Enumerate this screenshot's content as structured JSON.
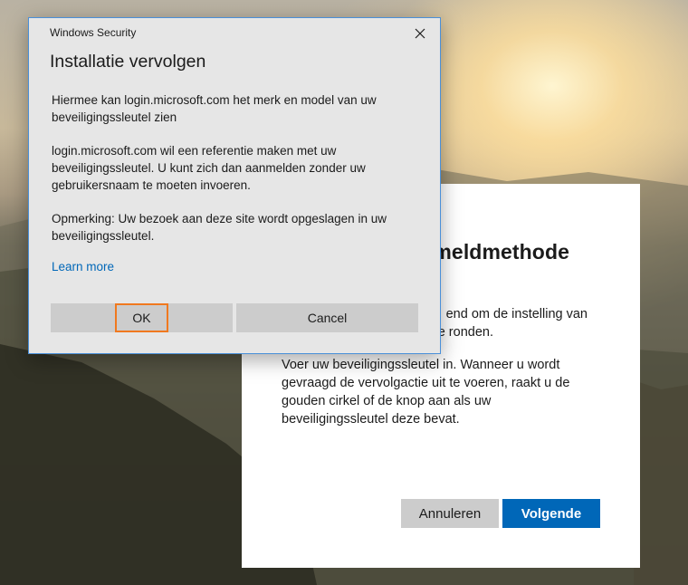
{
  "windows_security_dialog": {
    "window_title": "Windows Security",
    "heading": "Installatie vervolgen",
    "paragraph_1": "Hiermee kan login.microsoft.com het merk en model van uw beveiligingssleutel zien",
    "paragraph_2": "login.microsoft.com wil een referentie maken met uw beveiligingssleutel. U kunt zich dan aanmelden zonder uw gebruikersnaam te moeten invoeren.",
    "paragraph_3": "Opmerking: Uw bezoek aan deze site wordt opgeslagen in uw beveiligingssleutel.",
    "learn_more_link": "Learn more",
    "ok_button": "OK",
    "cancel_button": "Cancel",
    "close_icon": "close-icon",
    "focus_color": "#f0791f",
    "border_color": "#4a90d9"
  },
  "background_dialog": {
    "title_partial": "meldmethode",
    "line1_partial": "end om de instelling van",
    "line2_partial": "e ronden.",
    "instructions": "Voer uw beveiligingssleutel in. Wanneer u wordt gevraagd de vervolgactie uit te voeren, raakt u de gouden cirkel of de knop aan als uw beveiligingssleutel deze bevat.",
    "cancel_button": "Annuleren",
    "next_button": "Volgende",
    "accent_color": "#0067b8"
  }
}
